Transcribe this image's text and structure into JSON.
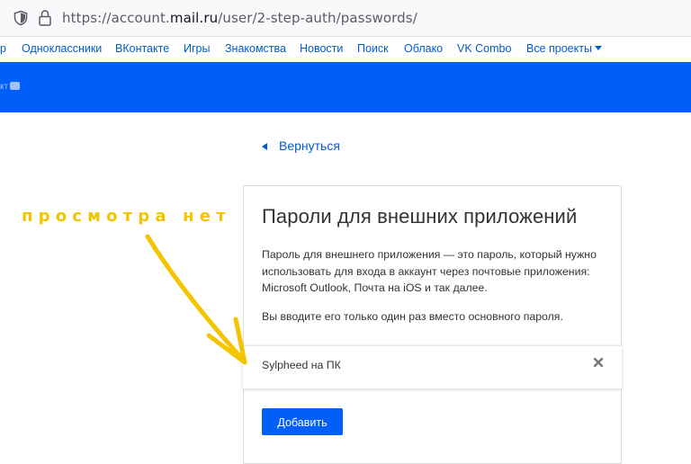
{
  "browser": {
    "url_prefix": "https://account.",
    "url_domain": "mail.ru",
    "url_path": "/user/2-step-auth/passwords/"
  },
  "portal_nav": {
    "items": [
      {
        "label": "р"
      },
      {
        "label": "Одноклассники"
      },
      {
        "label": "ВКонтакте"
      },
      {
        "label": "Игры"
      },
      {
        "label": "Знакомства"
      },
      {
        "label": "Новости"
      },
      {
        "label": "Поиск"
      },
      {
        "label": "Облако"
      },
      {
        "label": "VK Combo"
      },
      {
        "label": "Все проекты"
      }
    ]
  },
  "header": {
    "brand_fragment": "кт"
  },
  "back_link": {
    "label": "Вернуться"
  },
  "card": {
    "title": "Пароли для внешних приложений",
    "description": "Пароль для внешнего приложения — это пароль, который нужно использовать для входа в аккаунт через почтовые приложения: Microsoft Outlook, Почта на iOS и так далее.",
    "note": "Вы вводите его только один раз вместо основного пароля.",
    "passwords": [
      {
        "name": "Sylpheed на ПК"
      }
    ],
    "add_button": "Добавить"
  },
  "annotation": {
    "text": "просмотра нет"
  },
  "colors": {
    "brand_blue": "#005ff9",
    "link_blue": "#005bd1",
    "annotation_yellow": "#f5c400"
  }
}
